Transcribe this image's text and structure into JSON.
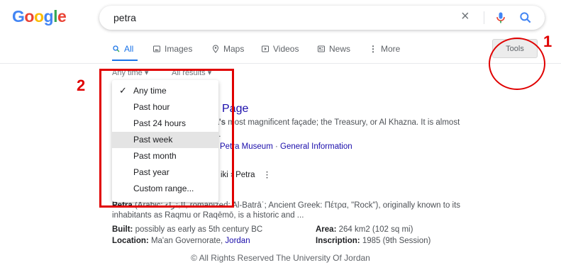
{
  "header": {
    "logo_text": "Google",
    "query": "petra",
    "clear_icon": "close-icon",
    "mic_icon": "mic-icon",
    "search_icon": "search-icon"
  },
  "tabs": [
    {
      "label": "All",
      "icon": "search-icon",
      "active": true
    },
    {
      "label": "Images",
      "icon": "image-icon",
      "active": false
    },
    {
      "label": "Maps",
      "icon": "map-pin-icon",
      "active": false
    },
    {
      "label": "Videos",
      "icon": "play-icon",
      "active": false
    },
    {
      "label": "News",
      "icon": "newspaper-icon",
      "active": false
    },
    {
      "label": "More",
      "icon": "more-dots-icon",
      "active": false
    }
  ],
  "tools_label": "Tools",
  "toolbar": {
    "time_filter": "Any time ▾",
    "results_filter": "All results ▾"
  },
  "dropdown": {
    "items": [
      "Any time",
      "Past hour",
      "Past 24 hours",
      "Past week",
      "Past month",
      "Past year",
      "Custom range..."
    ],
    "selected": "Any time",
    "highlighted": "Past week"
  },
  "annotations": {
    "num1": "1",
    "num2": "2",
    "color": "#e00000"
  },
  "results": {
    "title_fragment": "Page",
    "snippet1_bold": "ra's",
    "snippet1_rest": " most magnificent façade; the Treasury, or Al Khazna. It is almost",
    "snippet1_line2": "re.",
    "sitelink1": "Petra Museum",
    "sitelink_sep": " · ",
    "sitelink2": "General Information",
    "wiki_crumb": "iki › Petra",
    "wiki_menu": "⋮",
    "wiki_bold": "Petra",
    "wiki_line1_rest": " (Arabic: البتراء, romanized: Al-Batrāʾ; Ancient Greek: Πέτρα, \"Rock\"), originally known to its",
    "wiki_line2": "inhabitants as Raqmu or Raqēmō, is a historic and ...",
    "built_label": "Built:",
    "built_value": " possibly as early as 5th century BC",
    "area_label": "Area:",
    "area_value": " 264 km2 (102 sq mi)",
    "location_label": "Location:",
    "location_value1": " Ma'an Governorate, ",
    "location_value2": "Jordan",
    "inscription_label": "Inscription:",
    "inscription_value": " 1985 (9th Session)"
  },
  "footer": "© All Rights Reserved The University Of Jordan"
}
